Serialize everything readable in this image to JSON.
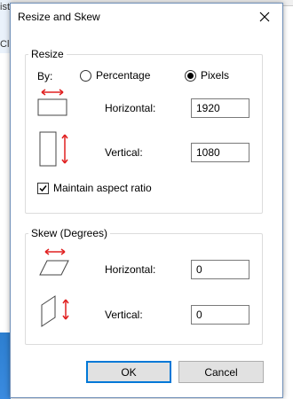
{
  "background": {
    "title_fragment": "iste",
    "fragment2": "Cli"
  },
  "dialog": {
    "title": "Resize and Skew"
  },
  "resize": {
    "legend": "Resize",
    "by_label": "By:",
    "percentage_label": "Percentage",
    "pixels_label": "Pixels",
    "selected": "pixels",
    "horizontal_label": "Horizontal:",
    "horizontal_value": "1920",
    "vertical_label": "Vertical:",
    "vertical_value": "1080",
    "maintain_label": "Maintain aspect ratio",
    "maintain_checked": true
  },
  "skew": {
    "legend": "Skew (Degrees)",
    "horizontal_label": "Horizontal:",
    "horizontal_value": "0",
    "vertical_label": "Vertical:",
    "vertical_value": "0"
  },
  "buttons": {
    "ok": "OK",
    "cancel": "Cancel"
  },
  "colors": {
    "arrow": "#e02020",
    "accent": "#0078d7"
  }
}
